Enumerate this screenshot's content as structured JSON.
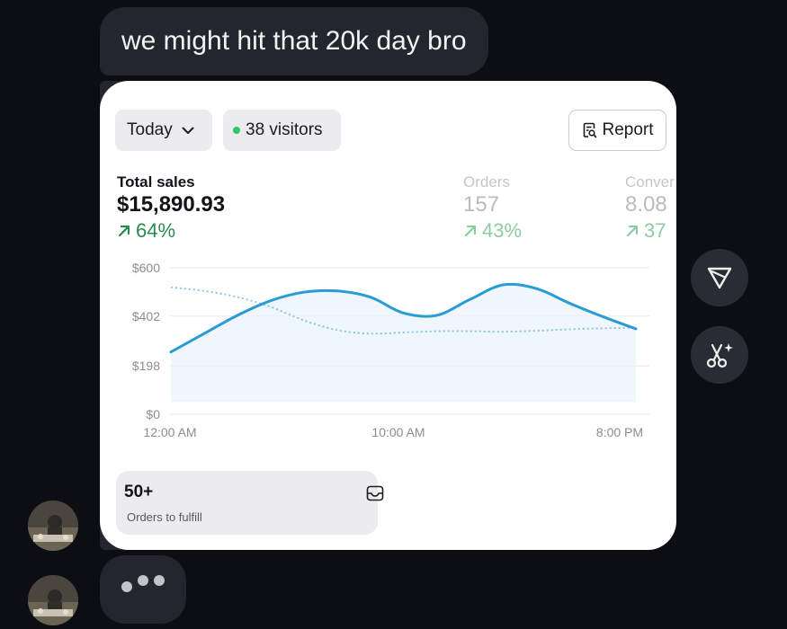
{
  "messages": {
    "incoming_text": "we might hit that 20k day bro"
  },
  "card": {
    "period_label": "Today",
    "visitors_label": "38 visitors",
    "report_label": "Report",
    "metrics": [
      {
        "label": "Total sales",
        "value": "$15,890.93",
        "change": "64%"
      },
      {
        "label": "Orders",
        "value": "157",
        "change": "43%"
      },
      {
        "label": "Conver",
        "value": "8.08",
        "change": "37"
      }
    ],
    "fulfill": {
      "count": "50+",
      "label": "Orders to fulfill"
    }
  },
  "chart_data": {
    "type": "line",
    "y_tick_labels": [
      "$600",
      "$402",
      "$198",
      "$0"
    ],
    "y_tick_values": [
      600,
      402,
      198,
      0
    ],
    "x_tick_labels": [
      "12:00 AM",
      "10:00 AM",
      "8:00 PM"
    ],
    "ylim": [
      0,
      600
    ],
    "grid": true,
    "series": [
      {
        "style": "solid",
        "color": "#2b9bd6",
        "values": [
          255,
          330,
          405,
          465,
          500,
          505,
          480,
          415,
          405,
          470,
          530,
          515,
          455,
          400,
          350
        ]
      },
      {
        "style": "dotted",
        "color": "#8fc4e3",
        "values": [
          520,
          505,
          480,
          440,
          385,
          345,
          330,
          335,
          340,
          340,
          338,
          342,
          348,
          352,
          355
        ]
      }
    ]
  },
  "icons": {
    "chevron": "chevron-down-icon",
    "report": "report-search-icon",
    "send": "send-triangle-icon",
    "magic": "scissors-sparkle-icon",
    "inbox": "inbox-icon"
  }
}
